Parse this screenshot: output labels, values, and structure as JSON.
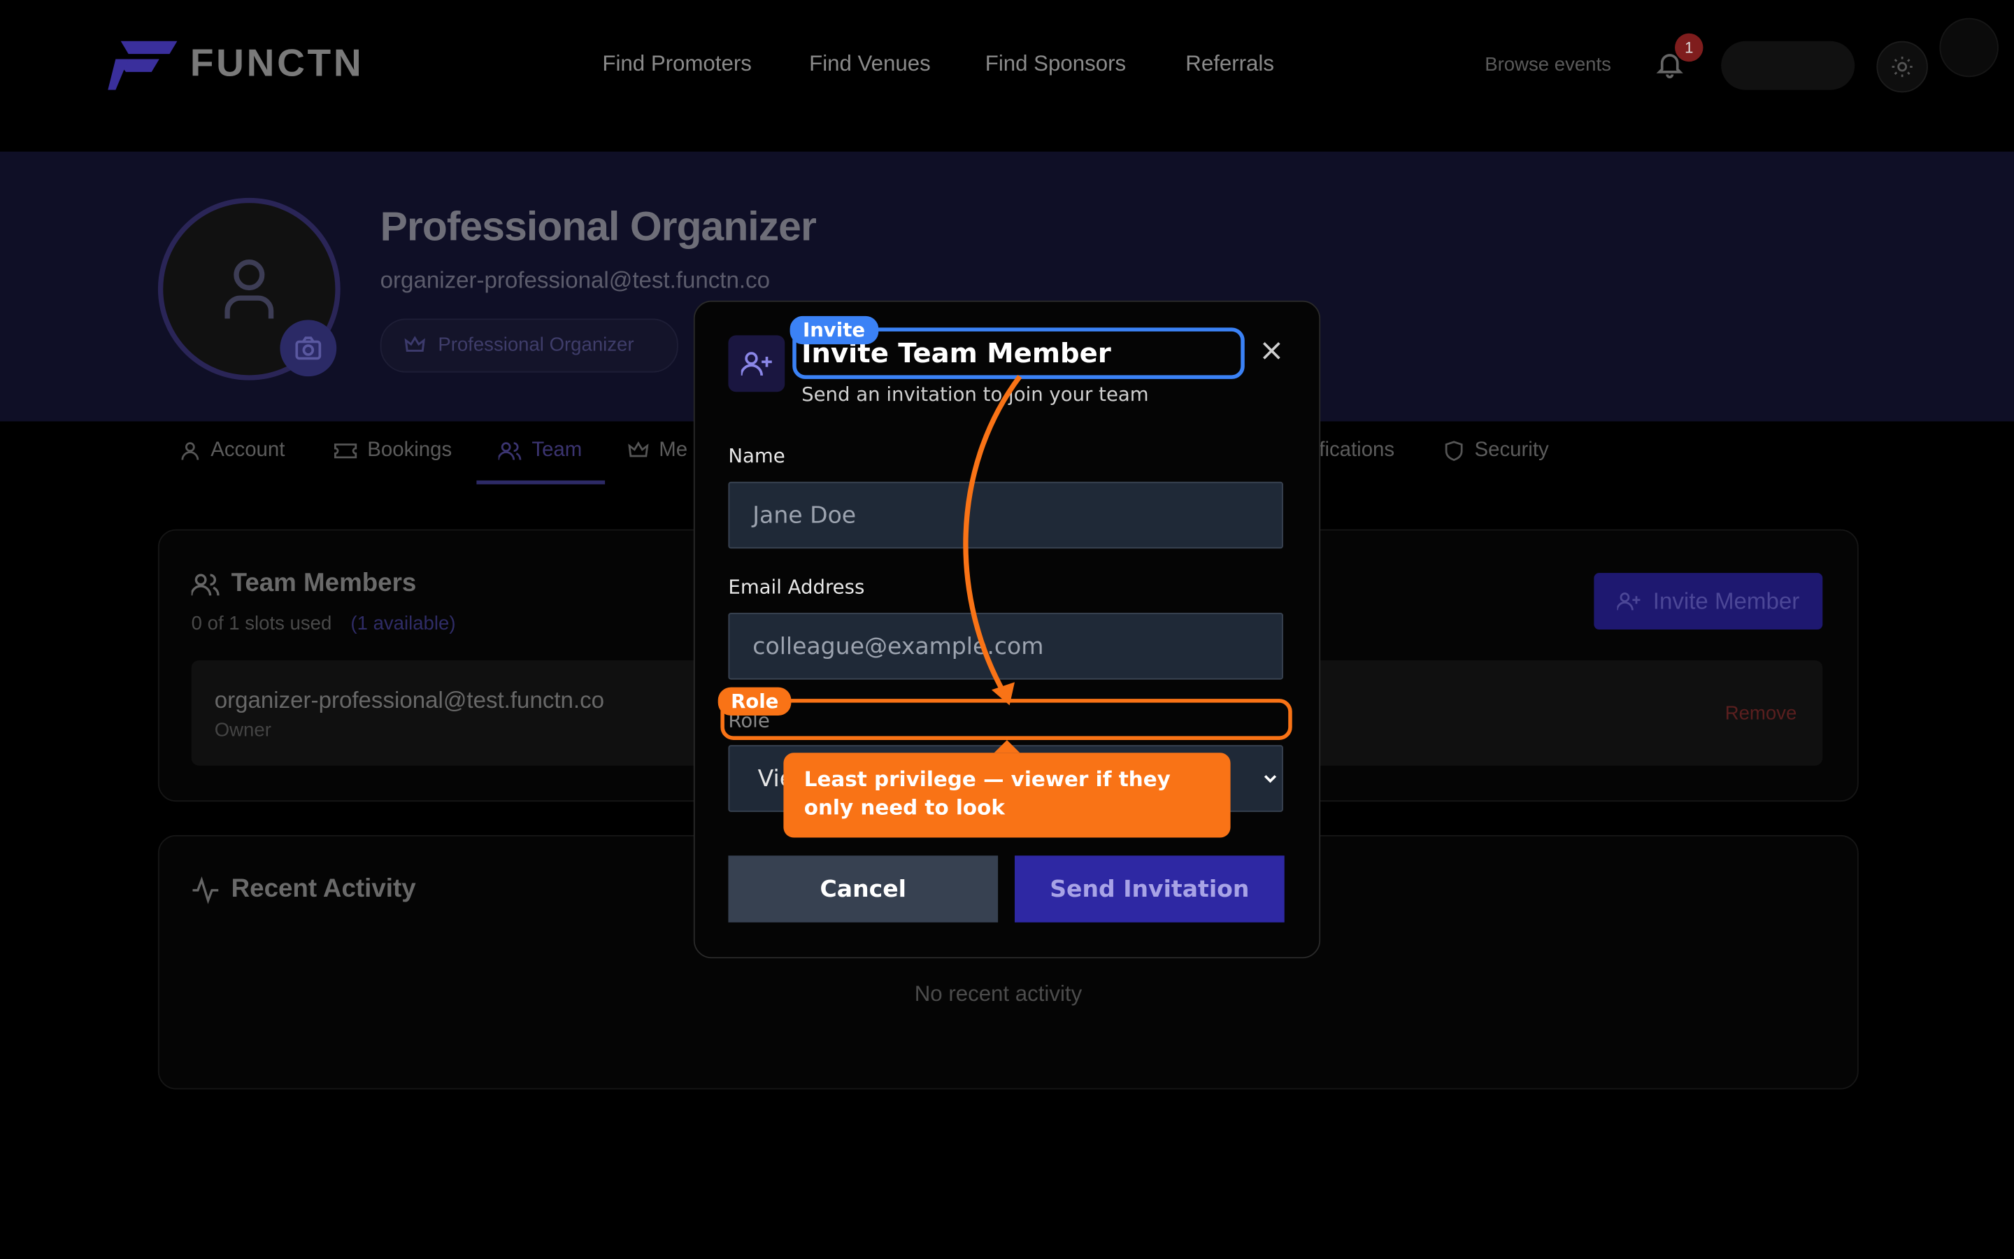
{
  "header": {
    "logo_text": "FUNCTN",
    "nav": [
      "Find Promoters",
      "Find Venues",
      "Find Sponsors",
      "Referrals"
    ],
    "browse_events": "Browse events",
    "notification_count": "1"
  },
  "profile": {
    "name": "Professional Organizer",
    "email": "organizer-professional@test.functn.co",
    "role_badge": "Professional Organizer"
  },
  "tabs": [
    "Account",
    "Bookings",
    "Team",
    "Me",
    "fications",
    "Security"
  ],
  "team": {
    "title": "Team Members",
    "slots": "0 of 1 slots used",
    "available": "(1 available)",
    "invite_button": "Invite Member",
    "member_email": "organizer-professional@test.functn.co",
    "member_role": "Owner",
    "remove": "Remove"
  },
  "activity": {
    "title": "Recent Activity",
    "empty": "No recent activity"
  },
  "modal": {
    "title": "Invite Team Member",
    "subtitle": "Send an invitation to join your team",
    "name_label": "Name",
    "name_placeholder": "Jane Doe",
    "email_label": "Email Address",
    "email_placeholder": "colleague@example.com",
    "role_label": "Role",
    "role_value": "Vie",
    "cancel": "Cancel",
    "send": "Send Invitation"
  },
  "annotations": {
    "invite_tag": "Invite",
    "role_tag": "Role",
    "callout": "Least privilege — viewer if they only need to look"
  },
  "colors": {
    "accent_orange": "#f97316",
    "accent_blue": "#3b82f6",
    "brand_indigo": "#2e28a3"
  }
}
